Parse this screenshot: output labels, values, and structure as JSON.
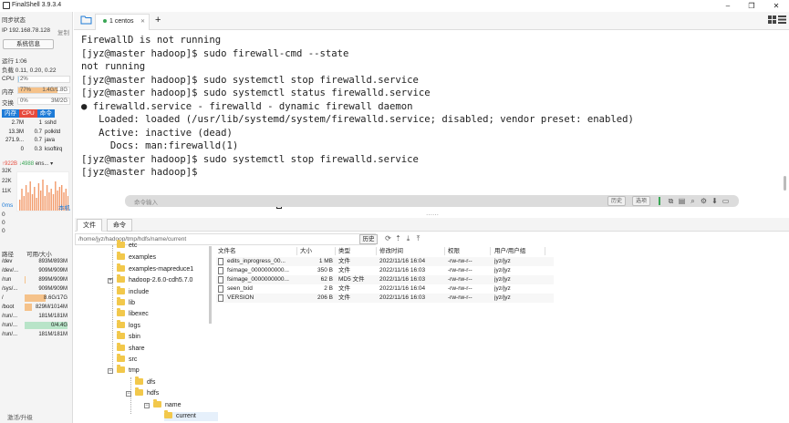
{
  "window": {
    "title": "FinalShell 3.9.3.4"
  },
  "sidebar": {
    "sync_status": "同步状态",
    "ip_label": "IP 192.168.78.128",
    "copy_label": "复制",
    "sysinfo_button": "系统信息",
    "uptime": "运行 1:06",
    "load": "负载 0.11, 0.20, 0.22",
    "cpu": {
      "label": "CPU",
      "value": "2%",
      "fraction": 0.02
    },
    "mem": {
      "label": "内存",
      "percent": "77%",
      "value": "1.4G/1.8G",
      "fraction": 0.77
    },
    "swap": {
      "label": "交换",
      "percent": "0%",
      "value": "3M/2G",
      "fraction": 0.0
    },
    "proc_tabs": [
      "内存",
      "CPU",
      "命令"
    ],
    "processes": [
      {
        "mem": "2.7M",
        "cpu": "1",
        "cmd": "sshd"
      },
      {
        "mem": "13.3M",
        "cpu": "0.7",
        "cmd": "polkitd"
      },
      {
        "mem": "271.9...",
        "cpu": "0.7",
        "cmd": "java"
      },
      {
        "mem": "0",
        "cpu": "0.3",
        "cmd": "ksoftirq"
      }
    ],
    "net": {
      "up": "↑922B",
      "down": "↓4988",
      "iface": "ens...",
      "ticks": [
        "32K",
        "22K",
        "11K"
      ]
    },
    "latency": {
      "value": "0ms",
      "host": "本机",
      "rows": [
        "0",
        "0",
        "0"
      ]
    },
    "disk_headers": [
      "路径",
      "可用/大小"
    ],
    "disks": [
      {
        "path": "/dev",
        "size": "893M/893M",
        "fraction": 0.0
      },
      {
        "path": "/dev/...",
        "size": "909M/909M",
        "fraction": 0.0
      },
      {
        "path": "/run",
        "size": "899M/909M",
        "fraction": 0.01
      },
      {
        "path": "/sys/...",
        "size": "909M/909M",
        "fraction": 0.0
      },
      {
        "path": "/",
        "size": "8.6G/17G",
        "fraction": 0.49
      },
      {
        "path": "/boot",
        "size": "829M/1014M",
        "fraction": 0.18
      },
      {
        "path": "/run/...",
        "size": "181M/181M",
        "fraction": 0.0
      },
      {
        "path": "/run/...",
        "size": "0/4.4G",
        "fraction": 1.0
      },
      {
        "path": "/run/...",
        "size": "181M/181M",
        "fraction": 0.0
      }
    ],
    "footer": "激活/升级"
  },
  "tabs": {
    "active": "1 centos",
    "add": "+"
  },
  "terminal": {
    "lines": [
      "FirewallD is not running",
      "[jyz@master hadoop]$ sudo firewall-cmd --state",
      "not running",
      "[jyz@master hadoop]$ sudo systemctl stop firewalld.service",
      "[jyz@master hadoop]$ sudo systemctl status firewalld.service",
      "● firewalld.service - firewalld - dynamic firewall daemon",
      "   Loaded: loaded (/usr/lib/systemd/system/firewalld.service; disabled; vendor preset: enabled)",
      "   Active: inactive (dead)",
      "     Docs: man:firewalld(1)",
      "[jyz@master hadoop]$ sudo systemctl stop firewalld.service",
      "[jyz@master hadoop]$ "
    ],
    "input_placeholder": "命令输入",
    "history_button": "历史",
    "options_button": "选项"
  },
  "bottom": {
    "tabs": [
      "文件",
      "命令"
    ],
    "path": "/home/jyz/hadoop/tmp/hdfs/name/current",
    "history_button": "历史",
    "tree": [
      {
        "label": "etc",
        "level": 2,
        "partial": true
      },
      {
        "label": "examples",
        "level": 2
      },
      {
        "label": "examples-mapreduce1",
        "level": 2
      },
      {
        "label": "hadoop-2.6.0-cdh5.7.0",
        "level": 2,
        "expander": "+"
      },
      {
        "label": "include",
        "level": 2
      },
      {
        "label": "lib",
        "level": 2
      },
      {
        "label": "libexec",
        "level": 2
      },
      {
        "label": "logs",
        "level": 2
      },
      {
        "label": "sbin",
        "level": 2
      },
      {
        "label": "share",
        "level": 2
      },
      {
        "label": "src",
        "level": 2
      },
      {
        "label": "tmp",
        "level": 2,
        "expander": "-"
      },
      {
        "label": "dfs",
        "level": 3
      },
      {
        "label": "hdfs",
        "level": 3,
        "expander": "-"
      },
      {
        "label": "name",
        "level": 4,
        "expander": "-"
      },
      {
        "label": "current",
        "level": 5,
        "selected": true
      }
    ],
    "columns": [
      "文件名",
      "大小",
      "类型",
      "修改时间",
      "权限",
      "用户/用户组"
    ],
    "files": [
      {
        "name": "edits_inprogress_00...",
        "size": "1 MB",
        "type": "文件",
        "mtime": "2022/11/16 16:04",
        "perm": "-rw-rw-r--",
        "owner": "jyz/jyz"
      },
      {
        "name": "fsimage_0000000000...",
        "size": "350 B",
        "type": "文件",
        "mtime": "2022/11/16 16:03",
        "perm": "-rw-rw-r--",
        "owner": "jyz/jyz"
      },
      {
        "name": "fsimage_0000000000...",
        "size": "62 B",
        "type": "MD5 文件",
        "mtime": "2022/11/16 16:03",
        "perm": "-rw-rw-r--",
        "owner": "jyz/jyz"
      },
      {
        "name": "seen_txid",
        "size": "2 B",
        "type": "文件",
        "mtime": "2022/11/16 16:04",
        "perm": "-rw-rw-r--",
        "owner": "jyz/jyz"
      },
      {
        "name": "VERSION",
        "size": "206 B",
        "type": "文件",
        "mtime": "2022/11/16 16:03",
        "perm": "-rw-rw-r--",
        "owner": "jyz/jyz"
      }
    ]
  },
  "colors": {
    "accent": "#1e7bd7",
    "tab_dot": "#3aa655",
    "mem_fill": "#f5c28a",
    "folder": "#f2c84b",
    "net_graph": "#f29a6a"
  }
}
